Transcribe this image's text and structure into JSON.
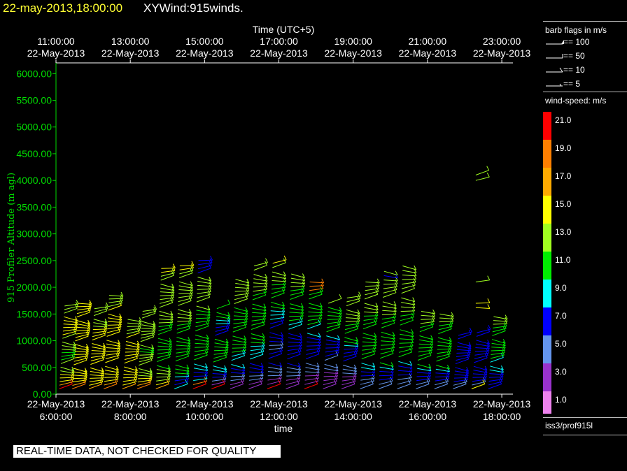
{
  "header": {
    "date_time": "22-may-2013,18:00:00",
    "name": "XYWind:915winds."
  },
  "sidebar": {
    "barb_title": "barb flags in m/s",
    "barb_items": [
      {
        "label": "== 100"
      },
      {
        "label": "== 50"
      },
      {
        "label": "== 10"
      },
      {
        "label": "== 5"
      }
    ],
    "speed_title": "wind-speed: m/s",
    "colorbar": [
      {
        "label": "21.0",
        "color": "#ff0000"
      },
      {
        "label": "19.0",
        "color": "#ff7f00"
      },
      {
        "label": "17.0",
        "color": "#ffaa00"
      },
      {
        "label": "15.0",
        "color": "#ffff00"
      },
      {
        "label": "13.0",
        "color": "#a0ff20"
      },
      {
        "label": "11.0",
        "color": "#00ee00"
      },
      {
        "label": "9.0",
        "color": "#00ffff"
      },
      {
        "label": "7.0",
        "color": "#0000ff"
      },
      {
        "label": "5.0",
        "color": "#6495ed"
      },
      {
        "label": "3.0",
        "color": "#9932cc"
      },
      {
        "label": "1.0",
        "color": "#ee82ee"
      }
    ],
    "station": "iss3/prof915l"
  },
  "footer": {
    "qc_notice": "REAL-TIME DATA, NOT CHECKED FOR QUALITY"
  },
  "chart_data": {
    "type": "scatter",
    "ylabel": "915 Profiler Altitude (m agl)",
    "xlabel": "time",
    "top_axis_title": "Time (UTC+5)",
    "ylim": [
      0,
      6200
    ],
    "yticks": [
      "0.00",
      "500.00",
      "1000.00",
      "1500.00",
      "2000.00",
      "2500.00",
      "3000.00",
      "3500.00",
      "4000.00",
      "4500.00",
      "5000.00",
      "5500.00",
      "6000.00"
    ],
    "xlim_hours": [
      6.0,
      18.3
    ],
    "bottom_ticks": [
      {
        "hour": 6,
        "date": "22-May-2013",
        "time": "6:00:00"
      },
      {
        "hour": 8,
        "date": "22-May-2013",
        "time": "8:00:00"
      },
      {
        "hour": 10,
        "date": "22-May-2013",
        "time": "10:00:00"
      },
      {
        "hour": 12,
        "date": "22-May-2013",
        "time": "12:00:00"
      },
      {
        "hour": 14,
        "date": "22-May-2013",
        "time": "14:00:00"
      },
      {
        "hour": 16,
        "date": "22-May-2013",
        "time": "16:00:00"
      },
      {
        "hour": 18,
        "date": "22-May-2013",
        "time": "18:00:00"
      }
    ],
    "top_ticks": [
      {
        "hour": 6,
        "time": "11:00:00",
        "date": "22-May-2013"
      },
      {
        "hour": 8,
        "time": "13:00:00",
        "date": "22-May-2013"
      },
      {
        "hour": 10,
        "time": "15:00:00",
        "date": "22-May-2013"
      },
      {
        "hour": 12,
        "time": "17:00:00",
        "date": "22-May-2013"
      },
      {
        "hour": 14,
        "time": "19:00:00",
        "date": "22-May-2013"
      },
      {
        "hour": 16,
        "time": "21:00:00",
        "date": "22-May-2013"
      },
      {
        "hour": 18,
        "time": "23:00:00",
        "date": "22-May-2013"
      }
    ],
    "profiles": [
      {
        "t": 6.2,
        "top": 1650,
        "levels": 24,
        "speeds": [
          21,
          17,
          15,
          15,
          15,
          13,
          13,
          13,
          11,
          11,
          11,
          13,
          13,
          13,
          13,
          15,
          15,
          15,
          15,
          15,
          15,
          13,
          13,
          13
        ]
      },
      {
        "t": 6.55,
        "top": 1700,
        "levels": 26,
        "speeds": [
          19,
          17,
          15,
          15,
          15,
          15,
          15,
          15,
          15,
          15,
          15,
          15,
          15,
          15,
          15,
          15,
          15,
          15,
          15,
          15,
          15,
          15,
          15,
          15,
          15,
          15
        ]
      },
      {
        "t": 7.0,
        "top": 1600,
        "levels": 24,
        "speeds": [
          17,
          15,
          15,
          15,
          15,
          15,
          15,
          15,
          15,
          15,
          15,
          15,
          15,
          15,
          15,
          15,
          15,
          15,
          13,
          13,
          13,
          13,
          13,
          13
        ]
      },
      {
        "t": 7.4,
        "top": 1850,
        "levels": 26,
        "speeds": [
          19,
          17,
          15,
          15,
          15,
          15,
          15,
          15,
          15,
          15,
          15,
          15,
          15,
          15,
          15,
          15,
          15,
          15,
          15,
          15,
          15,
          15,
          13,
          13,
          13,
          13
        ]
      },
      {
        "t": 7.9,
        "top": 1400,
        "levels": 20,
        "speeds": [
          17,
          15,
          15,
          15,
          15,
          15,
          15,
          15,
          15,
          15,
          15,
          15,
          15,
          15,
          15,
          13,
          13,
          13,
          13,
          13
        ]
      },
      {
        "t": 8.3,
        "top": 1550,
        "levels": 24,
        "speeds": [
          19,
          17,
          15,
          15,
          13,
          13,
          13,
          13,
          13,
          13,
          13,
          11,
          11,
          13,
          13,
          13,
          13,
          13,
          13,
          13,
          13,
          13,
          13,
          13
        ]
      },
      {
        "t": 8.8,
        "top": 2350,
        "levels": 32,
        "speeds": [
          17,
          15,
          13,
          13,
          13,
          13,
          11,
          11,
          11,
          11,
          11,
          11,
          11,
          11,
          11,
          11,
          11,
          13,
          13,
          13,
          13,
          13,
          13,
          13,
          13,
          13,
          13,
          13,
          13,
          13,
          15,
          15
        ]
      },
      {
        "t": 9.3,
        "top": 2400,
        "levels": 32,
        "speeds": [
          9,
          7,
          7,
          9,
          11,
          11,
          11,
          11,
          11,
          11,
          11,
          11,
          11,
          11,
          11,
          11,
          11,
          13,
          13,
          13,
          13,
          13,
          13,
          13,
          13,
          13,
          13,
          13,
          13,
          13,
          15,
          15
        ]
      },
      {
        "t": 9.8,
        "top": 2500,
        "levels": 32,
        "speeds": [
          21,
          19,
          9,
          7,
          7,
          9,
          9,
          11,
          11,
          11,
          11,
          11,
          11,
          11,
          11,
          11,
          11,
          11,
          11,
          11,
          13,
          13,
          13,
          13,
          13,
          13,
          13,
          13,
          7,
          7,
          7,
          7
        ]
      },
      {
        "t": 10.3,
        "top": 1600,
        "levels": 22,
        "speeds": [
          21,
          3,
          5,
          7,
          7,
          9,
          9,
          11,
          11,
          11,
          11,
          11,
          11,
          11,
          7,
          7,
          7,
          9,
          9,
          11,
          11,
          11
        ]
      },
      {
        "t": 10.8,
        "top": 2150,
        "levels": 28,
        "speeds": [
          3,
          3,
          5,
          5,
          7,
          7,
          9,
          9,
          9,
          11,
          11,
          11,
          11,
          11,
          11,
          11,
          11,
          11,
          11,
          11,
          11,
          13,
          13,
          13,
          13,
          13,
          13,
          13
        ]
      },
      {
        "t": 11.3,
        "top": 2400,
        "levels": 30,
        "speeds": [
          3,
          3,
          5,
          5,
          7,
          7,
          7,
          9,
          9,
          9,
          9,
          11,
          11,
          11,
          11,
          11,
          11,
          11,
          11,
          11,
          11,
          11,
          11,
          13,
          13,
          13,
          13,
          13,
          13,
          13
        ]
      },
      {
        "t": 11.8,
        "top": 2450,
        "levels": 30,
        "speeds": [
          21,
          3,
          3,
          5,
          5,
          5,
          7,
          7,
          7,
          5,
          5,
          7,
          7,
          7,
          7,
          7,
          9,
          9,
          9,
          11,
          11,
          11,
          11,
          11,
          11,
          13,
          13,
          13,
          13,
          15
        ]
      },
      {
        "t": 12.3,
        "top": 2250,
        "levels": 28,
        "speeds": [
          3,
          3,
          3,
          5,
          5,
          5,
          7,
          7,
          7,
          7,
          7,
          7,
          7,
          7,
          9,
          9,
          11,
          11,
          11,
          11,
          11,
          11,
          11,
          11,
          13,
          13,
          13,
          13
        ]
      },
      {
        "t": 12.8,
        "top": 2100,
        "levels": 26,
        "speeds": [
          21,
          3,
          3,
          3,
          5,
          5,
          5,
          7,
          7,
          7,
          7,
          7,
          7,
          9,
          9,
          11,
          11,
          11,
          11,
          11,
          11,
          11,
          11,
          19,
          19,
          19
        ]
      },
      {
        "t": 13.3,
        "top": 1700,
        "levels": 22,
        "speeds": [
          3,
          3,
          3,
          3,
          3,
          5,
          5,
          5,
          7,
          7,
          7,
          7,
          7,
          9,
          11,
          11,
          11,
          11,
          11,
          11,
          11,
          13
        ]
      },
      {
        "t": 13.8,
        "top": 1800,
        "levels": 24,
        "speeds": [
          3,
          3,
          3,
          3,
          5,
          5,
          5,
          7,
          7,
          7,
          7,
          9,
          11,
          11,
          11,
          11,
          11,
          13,
          13,
          13,
          13,
          13,
          13,
          13
        ]
      },
      {
        "t": 14.3,
        "top": 2100,
        "levels": 26,
        "speeds": [
          5,
          5,
          5,
          7,
          7,
          9,
          9,
          11,
          11,
          11,
          11,
          11,
          11,
          11,
          11,
          11,
          11,
          11,
          13,
          13,
          13,
          13,
          13,
          13,
          13,
          13
        ]
      },
      {
        "t": 14.8,
        "top": 2300,
        "levels": 28,
        "speeds": [
          5,
          5,
          7,
          7,
          7,
          9,
          11,
          11,
          11,
          11,
          11,
          11,
          11,
          11,
          11,
          11,
          11,
          13,
          13,
          13,
          13,
          13,
          13,
          13,
          13,
          13,
          7,
          13
        ]
      },
      {
        "t": 15.3,
        "top": 2400,
        "levels": 28,
        "speeds": [
          5,
          5,
          5,
          7,
          7,
          7,
          9,
          11,
          11,
          11,
          11,
          11,
          11,
          11,
          11,
          11,
          11,
          13,
          13,
          13,
          13,
          13,
          13,
          13,
          13,
          13,
          13,
          13
        ]
      },
      {
        "t": 15.8,
        "top": 1550,
        "levels": 20,
        "speeds": [
          5,
          5,
          7,
          7,
          7,
          9,
          11,
          11,
          11,
          11,
          11,
          11,
          11,
          11,
          11,
          11,
          13,
          13,
          13,
          13
        ]
      },
      {
        "t": 16.3,
        "top": 1500,
        "levels": 20,
        "speeds": [
          5,
          5,
          7,
          7,
          7,
          9,
          11,
          11,
          11,
          11,
          11,
          11,
          11,
          11,
          11,
          11,
          11,
          13,
          13,
          13
        ]
      },
      {
        "t": 16.8,
        "top": 1100,
        "levels": 16,
        "speeds": [
          5,
          5,
          7,
          7,
          7,
          7,
          7,
          7,
          7,
          7,
          7,
          7,
          7,
          7,
          7,
          7
        ]
      },
      {
        "t": 17.3,
        "top": 1150,
        "levels": 16,
        "speeds": [
          15,
          5,
          7,
          7,
          7,
          7,
          7,
          7,
          7,
          7,
          7,
          7,
          7,
          7,
          7,
          7
        ]
      },
      {
        "t": 17.75,
        "top": 1450,
        "levels": 20,
        "speeds": [
          7,
          7,
          7,
          7,
          7,
          9,
          9,
          9,
          11,
          11,
          11,
          11,
          11,
          11,
          11,
          11,
          11,
          13,
          13,
          13
        ]
      }
    ],
    "extra_barbs": [
      {
        "t": 17.3,
        "alt": 4100,
        "speed": 13
      },
      {
        "t": 17.3,
        "alt": 4000,
        "speed": 13
      },
      {
        "t": 17.3,
        "alt": 2100,
        "speed": 13
      },
      {
        "t": 17.3,
        "alt": 1700,
        "speed": 15
      },
      {
        "t": 17.3,
        "alt": 1620,
        "speed": 15
      }
    ]
  }
}
